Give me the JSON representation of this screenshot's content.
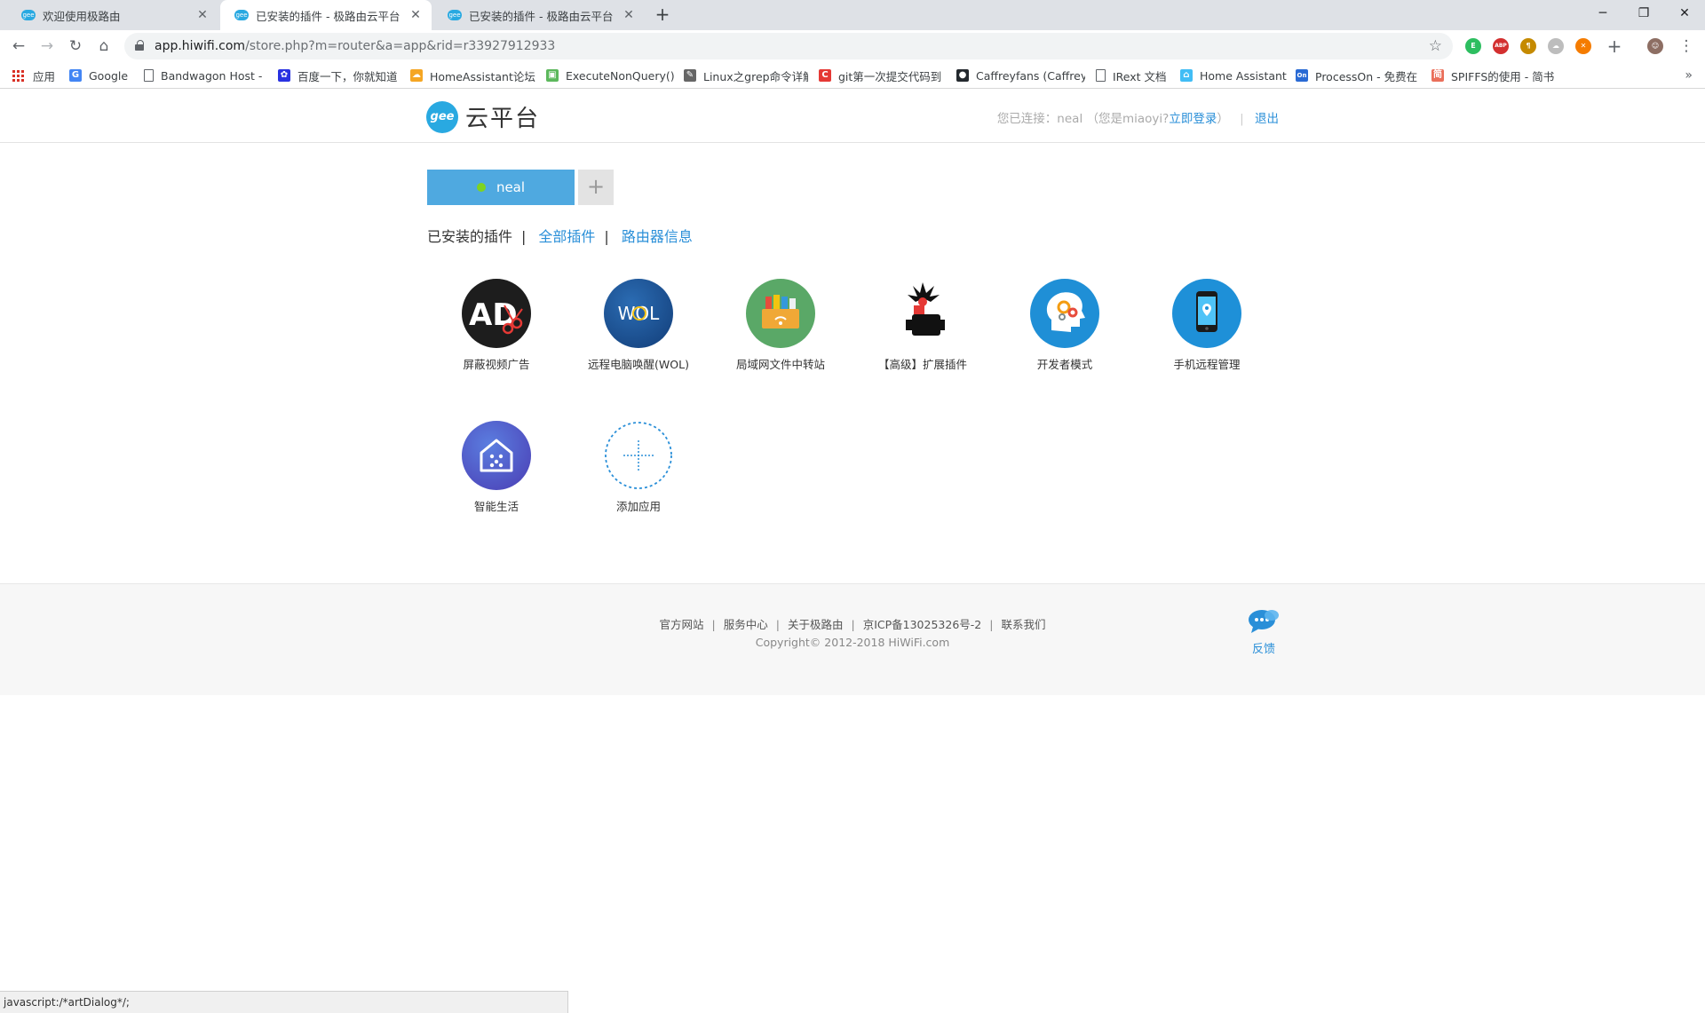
{
  "browser": {
    "tabs": [
      {
        "title": "欢迎使用极路由",
        "favicon": "gee-favicon"
      },
      {
        "title": "已安装的插件 - 极路由云平台",
        "favicon": "gee-favicon",
        "active": true
      },
      {
        "title": "已安装的插件 - 极路由云平台",
        "favicon": "gee-favicon"
      }
    ],
    "favicon_text": "gee",
    "url_host": "app.hiwifi.com",
    "url_rest": "/store.php?m=router&a=app&rid=r33927912933",
    "bookmarks": [
      {
        "label": "应用",
        "icon": "apps-grid-icon"
      },
      {
        "label": "Google",
        "icon": "google-icon",
        "color": "#4285f4",
        "glyph": "G"
      },
      {
        "label": "Bandwagon Host -",
        "icon": "page-icon"
      },
      {
        "label": "百度一下，你就知道",
        "icon": "baidu-paw-icon",
        "color": "#2932e1",
        "glyph": "✿"
      },
      {
        "label": "HomeAssistant论坛",
        "icon": "homeassistant-forum-icon",
        "color": "#f5a623",
        "glyph": "☁"
      },
      {
        "label": "ExecuteNonQuery()",
        "icon": "blog-icon",
        "color": "#5cb85c",
        "glyph": "▣"
      },
      {
        "label": "Linux之grep命令详解",
        "icon": "pen-icon",
        "color": "#666666",
        "glyph": "✎"
      },
      {
        "label": "git第一次提交代码到",
        "icon": "csdn-icon",
        "color": "#e53935",
        "glyph": "C"
      },
      {
        "label": "Caffreyfans (Caffrey",
        "icon": "github-icon",
        "color": "#24292e",
        "glyph": "●"
      },
      {
        "label": "IRext 文档",
        "icon": "page-icon"
      },
      {
        "label": "Home Assistant",
        "icon": "home-assistant-icon",
        "color": "#41bdf5",
        "glyph": "⌂"
      },
      {
        "label": "ProcessOn - 免费在",
        "icon": "processon-icon",
        "color": "#2a6ad4",
        "glyph": "On"
      },
      {
        "label": "SPIFFS的使用 - 简书",
        "icon": "jianshu-icon",
        "color": "#ea6f5a",
        "glyph": "简"
      }
    ],
    "extensions": [
      {
        "name": "evernote-extension-icon",
        "color": "#2dbe60",
        "glyph": "E"
      },
      {
        "name": "adblock-extension-icon",
        "color": "#d32f2f",
        "glyph": "ABP"
      },
      {
        "name": "pilcrow-extension-icon",
        "color": "#c58a00",
        "glyph": "¶"
      },
      {
        "name": "cloud-extension-icon",
        "color": "#bdbdbd",
        "glyph": "☁"
      },
      {
        "name": "orange-extension-icon",
        "color": "#f57c00",
        "glyph": "✕"
      }
    ],
    "status_text": "javascript:/*artDialog*/;"
  },
  "header": {
    "logo_mark": "gee",
    "logo_text": "云平台",
    "connected_prefix": "您已连接：neal",
    "identity_prefix": "（您是miaoyi?",
    "login_label": "立即登录",
    "identity_suffix": "）",
    "logout_label": "退出"
  },
  "router": {
    "name": "neal",
    "online_color": "#7ed321",
    "add_label": "+"
  },
  "subnav": {
    "installed": "已安装的插件",
    "all": "全部插件",
    "router_info": "路由器信息"
  },
  "apps": [
    {
      "label": "屏蔽视频广告",
      "icon": "ad-block-scissors-icon"
    },
    {
      "label": "远程电脑唤醒(WOL)",
      "icon": "wol-power-icon",
      "glyph": "WOL"
    },
    {
      "label": "局域网文件中转站",
      "icon": "file-transfer-box-icon"
    },
    {
      "label": "【高级】扩展插件",
      "icon": "advanced-extension-icon"
    },
    {
      "label": "开发者模式",
      "icon": "developer-head-gears-icon"
    },
    {
      "label": "手机远程管理",
      "icon": "mobile-remote-icon"
    },
    {
      "label": "智能生活",
      "icon": "smart-home-icon"
    },
    {
      "label": "添加应用",
      "icon": "add-app-dashed-icon"
    }
  ],
  "ad_icon_text": "AD",
  "footer": {
    "links": [
      "官方网站",
      "服务中心",
      "关于极路由",
      "京ICP备13025326号-2",
      "联系我们"
    ],
    "copyright": "Copyright© 2012-2018 HiWiFi.com",
    "feedback_label": "反馈"
  },
  "colors": {
    "accent": "#2a8fd8",
    "router_tab": "#4fa9e0"
  }
}
